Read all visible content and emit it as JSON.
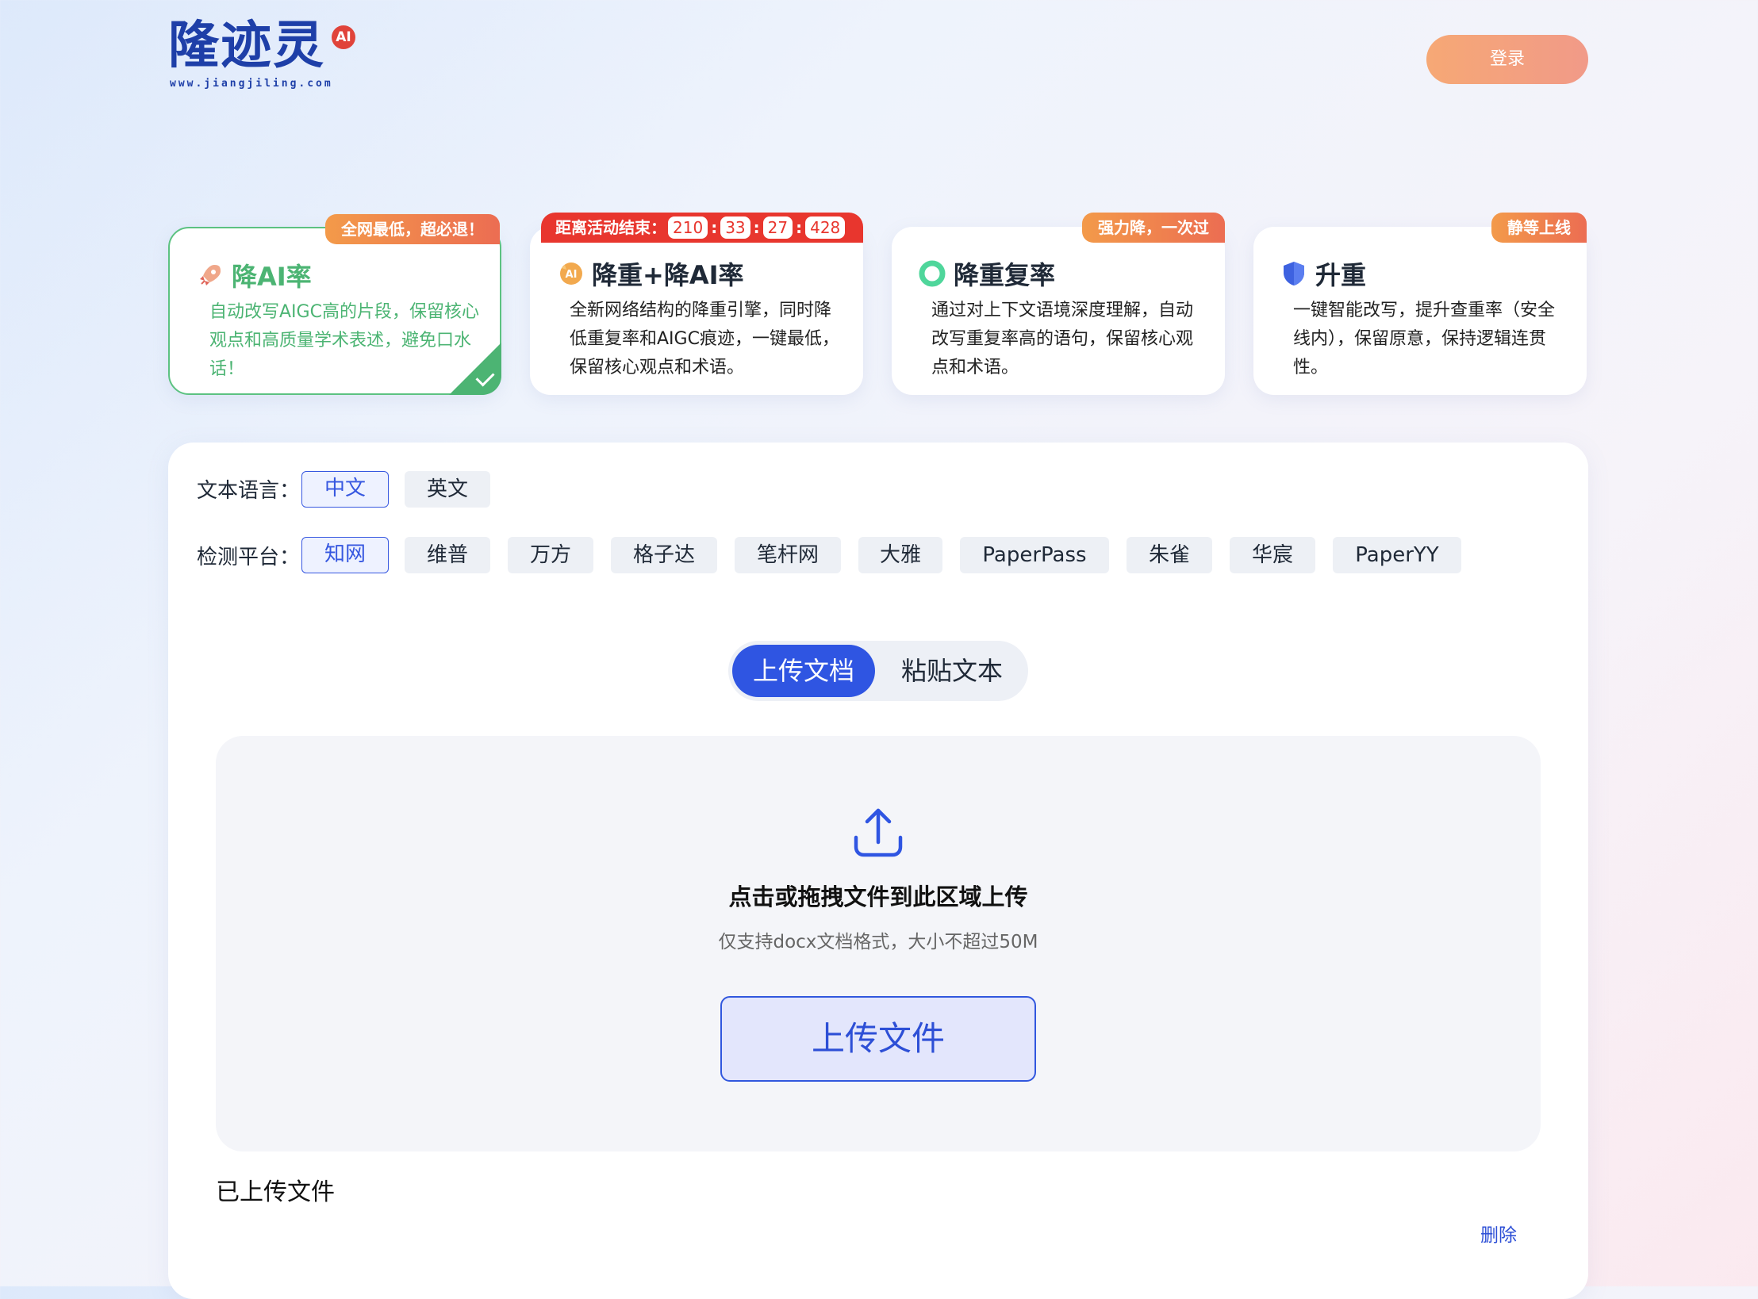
{
  "header": {
    "logo_text": "隆迹灵",
    "logo_badge": "AI",
    "logo_url": "www.jiangjiling.com",
    "login_label": "登录"
  },
  "cards": [
    {
      "badge": "全网最低，超必退！",
      "title": "降AI率",
      "icon": "rocket-icon",
      "desc": "自动改写AIGC高的片段，保留核心观点和高质量学术表述，避免口水话！",
      "active": true
    },
    {
      "badge_prefix": "距离活动结束：",
      "timer": [
        "210",
        "33",
        "27",
        "428"
      ],
      "title": "降重+降AI率",
      "icon": "ai-badge-icon",
      "desc": "全新网络结构的降重引擎，同时降低重复率和AIGC痕迹，一键最低，保留核心观点和术语。",
      "active": false
    },
    {
      "badge": "强力降，一次过",
      "title": "降重复率",
      "icon": "ring-icon",
      "desc": "通过对上下文语境深度理解，自动改写重复率高的语句，保留核心观点和术语。",
      "active": false
    },
    {
      "badge": "静等上线",
      "title": "升重",
      "icon": "shield-icon",
      "desc": "一键智能改写，提升查重率（安全线内），保留原意，保持逻辑连贯性。",
      "active": false
    }
  ],
  "language": {
    "label": "文本语言：",
    "options": [
      "中文",
      "英文"
    ],
    "selected": "中文"
  },
  "platform": {
    "label": "检测平台：",
    "options": [
      "知网",
      "维普",
      "万方",
      "格子达",
      "笔杆网",
      "大雅",
      "PaperPass",
      "朱雀",
      "华宸",
      "PaperYY"
    ],
    "selected": "知网"
  },
  "tabs": {
    "upload_doc": "上传文档",
    "paste_text": "粘贴文本",
    "active": "上传文档"
  },
  "dropzone": {
    "title": "点击或拖拽文件到此区域上传",
    "subtitle": "仅支持docx文档格式，大小不超过50M",
    "button": "上传文件"
  },
  "uploaded": {
    "label": "已上传文件",
    "delete": "删除"
  },
  "colors": {
    "primary": "#2f55e2",
    "active_green": "#4cb473",
    "badge_orange": "#ec6d52",
    "timer_red": "#e8362e",
    "login_orange": "#f6a875"
  }
}
